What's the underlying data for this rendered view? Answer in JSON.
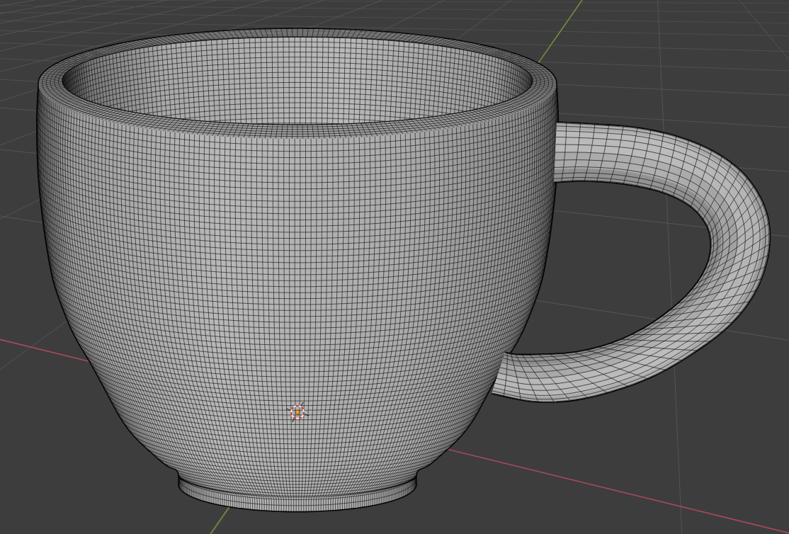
{
  "viewport": {
    "axes": [
      {
        "color": "#a8475a"
      },
      {
        "color": "#6f8d3c"
      }
    ]
  }
}
